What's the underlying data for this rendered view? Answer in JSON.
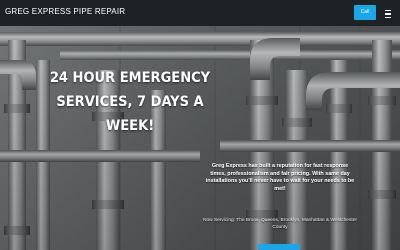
{
  "header": {
    "brand": "GREG EXPRESS PIPE REPAIR",
    "call_label": "Call"
  },
  "hero": {
    "heading": "24 HOUR EMERGENCY SERVICES, 7 DAYS A WEEK!",
    "tagline": "Greg Express has built a reputation for fast response times, professionalism and fair pricing. With same day installations you'll never have to wait for your needs to be met!",
    "service_areas": "Now Servicing: The Bronx, Queens, Brooklyn, Manhattan & Westchester County"
  },
  "colors": {
    "header_bg": "#1f2224",
    "accent": "#1aa7e8",
    "text": "#ffffff"
  },
  "icons": {
    "menu": "hamburger-menu-icon"
  }
}
